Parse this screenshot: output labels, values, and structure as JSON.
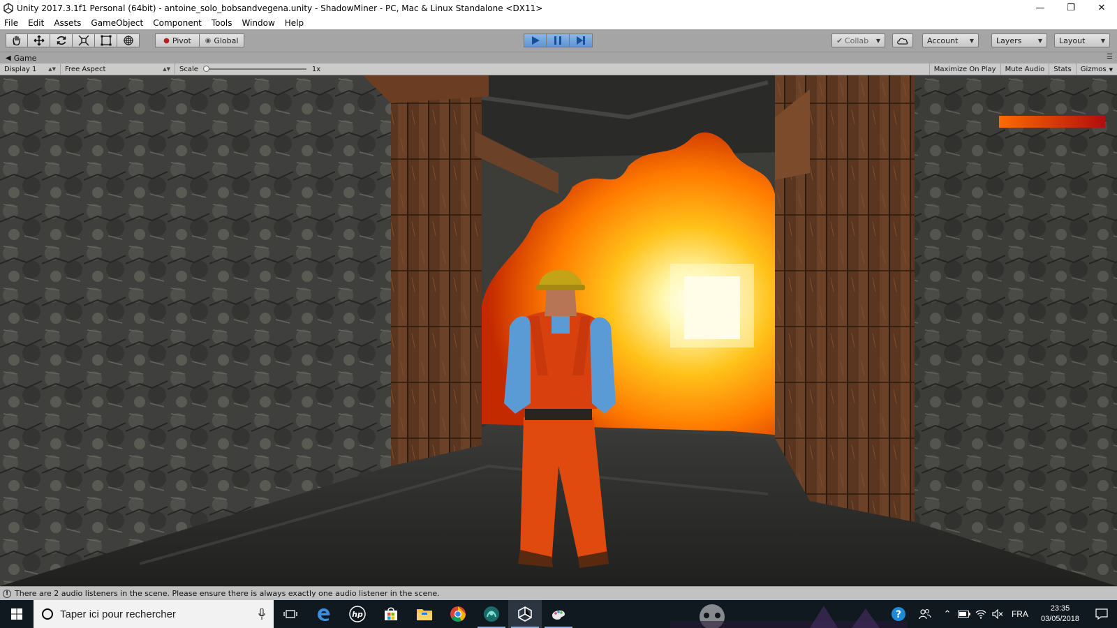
{
  "window": {
    "title": "Unity 2017.3.1f1 Personal (64bit) - antoine_solo_bobsandvegena.unity - ShadowMiner - PC, Mac & Linux Standalone <DX11>",
    "controls": [
      "minimize",
      "restore",
      "close"
    ]
  },
  "menu": {
    "items": [
      "File",
      "Edit",
      "Assets",
      "GameObject",
      "Component",
      "Tools",
      "Window",
      "Help"
    ]
  },
  "toolbar": {
    "tools": [
      "hand-tool",
      "move-tool",
      "rotate-tool",
      "scale-tool",
      "rect-tool",
      "transform-tool"
    ],
    "pivot_label": "Pivot",
    "global_label": "Global",
    "play_state": "playing",
    "collab_label": "Collab",
    "account_label": "Account",
    "layers_label": "Layers",
    "layout_label": "Layout",
    "accent_color": "#5d95d4"
  },
  "game_panel": {
    "tab_label": "Game",
    "display_label": "Display 1",
    "aspect_label": "Free Aspect",
    "scale_label": "Scale",
    "scale_value": "1x",
    "maximize_label": "Maximize On Play",
    "mute_label": "Mute Audio",
    "stats_label": "Stats",
    "gizmos_label": "Gizmos"
  },
  "game_hud": {
    "health_fraction": 1.0,
    "health_colors": [
      "#ff6a00",
      "#b30d0d"
    ]
  },
  "status": {
    "message": "There are 2 audio listeners in the scene. Please ensure there is always exactly one audio listener in the scene."
  },
  "taskbar": {
    "search_placeholder": "Taper ici pour rechercher",
    "apps": [
      "task-view",
      "edge",
      "hp",
      "store",
      "file-explorer",
      "chrome",
      "app-teal",
      "unity",
      "paint"
    ],
    "language": "FRA",
    "time": "23:35",
    "date": "03/05/2018"
  }
}
